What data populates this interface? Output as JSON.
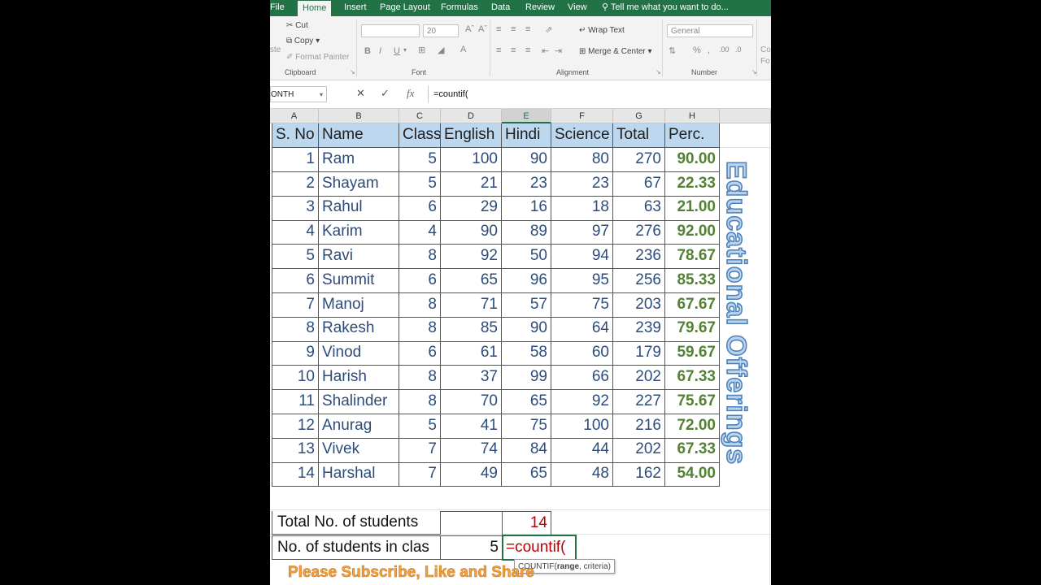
{
  "ribbon": {
    "tabs": [
      "File",
      "Home",
      "Insert",
      "Page Layout",
      "Formulas",
      "Data",
      "Review",
      "View"
    ],
    "active_tab": "Home",
    "tell_me": "Tell me what you want to do...",
    "clipboard": {
      "cut": "Cut",
      "copy": "Copy",
      "format_painter": "Format Painter",
      "paste_fragment": "ste",
      "label": "Clipboard"
    },
    "font": {
      "size": "20",
      "bold": "B",
      "italic": "I",
      "underline": "U",
      "label": "Font"
    },
    "alignment": {
      "wrap_text": "Wrap Text",
      "merge_center": "Merge & Center",
      "label": "Alignment"
    },
    "number": {
      "format": "General",
      "percent": "%",
      "label": "Number",
      "cond_fragment": "Co",
      "format_fragment": "Fo"
    }
  },
  "formula_bar": {
    "name_box": "ONTH",
    "formula": "=countif(",
    "fx": "fx"
  },
  "columns": [
    "A",
    "B",
    "C",
    "D",
    "E",
    "F",
    "G",
    "H"
  ],
  "table": {
    "headers": [
      "S. No",
      "Name",
      "Class",
      "English",
      "Hindi",
      "Science",
      "Total",
      "Perc."
    ],
    "rows": [
      [
        "1",
        "Ram",
        "5",
        "100",
        "90",
        "80",
        "270",
        "90.00"
      ],
      [
        "2",
        "Shayam",
        "5",
        "21",
        "23",
        "23",
        "67",
        "22.33"
      ],
      [
        "3",
        "Rahul",
        "6",
        "29",
        "16",
        "18",
        "63",
        "21.00"
      ],
      [
        "4",
        "Karim",
        "4",
        "90",
        "89",
        "97",
        "276",
        "92.00"
      ],
      [
        "5",
        "Ravi",
        "8",
        "92",
        "50",
        "94",
        "236",
        "78.67"
      ],
      [
        "6",
        "Summit",
        "6",
        "65",
        "96",
        "95",
        "256",
        "85.33"
      ],
      [
        "7",
        "Manoj",
        "8",
        "71",
        "57",
        "75",
        "203",
        "67.67"
      ],
      [
        "8",
        "Rakesh",
        "8",
        "85",
        "90",
        "64",
        "239",
        "79.67"
      ],
      [
        "9",
        "Vinod",
        "6",
        "61",
        "58",
        "60",
        "179",
        "59.67"
      ],
      [
        "10",
        "Harish",
        "8",
        "37",
        "99",
        "66",
        "202",
        "67.33"
      ],
      [
        "11",
        "Shalinder",
        "8",
        "70",
        "65",
        "92",
        "227",
        "75.67"
      ],
      [
        "12",
        "Anurag",
        "5",
        "41",
        "75",
        "100",
        "216",
        "72.00"
      ],
      [
        "13",
        "Vivek",
        "7",
        "74",
        "84",
        "44",
        "202",
        "67.33"
      ],
      [
        "14",
        "Harshal",
        "7",
        "49",
        "65",
        "48",
        "162",
        "54.00"
      ]
    ]
  },
  "summary": {
    "total_label": "Total No. of students",
    "total_value": "14",
    "class_label": "No. of students in clas",
    "class_value": "5",
    "editing": "=countif(",
    "tooltip_fn": "COUNTIF(",
    "tooltip_arg1": "range",
    "tooltip_rest": ", criteria)"
  },
  "watermark": "Educational Offerings",
  "banner": "Please Subscribe, Like and Share"
}
